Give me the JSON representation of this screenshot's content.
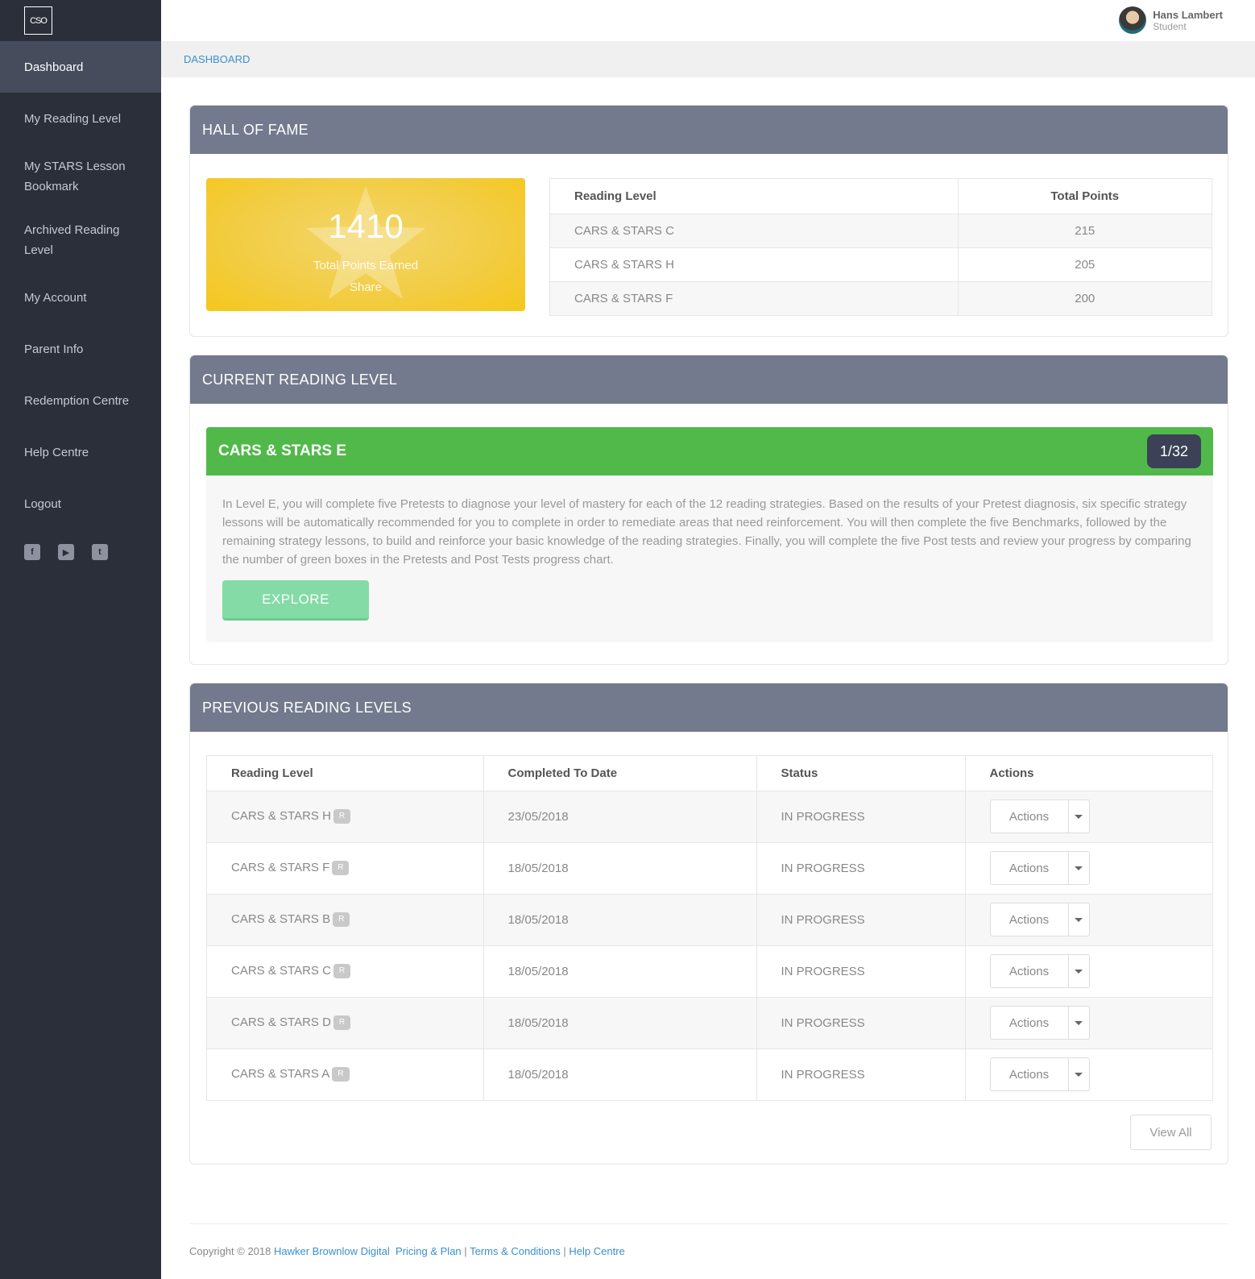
{
  "sidebar": {
    "logo": "CSO",
    "items": [
      {
        "label": "Dashboard"
      },
      {
        "label": "My Reading Level"
      },
      {
        "label": "My STARS Lesson Bookmark"
      },
      {
        "label": "Archived Reading Level"
      },
      {
        "label": "My Account"
      },
      {
        "label": "Parent Info"
      },
      {
        "label": "Redemption Centre"
      },
      {
        "label": "Help Centre"
      },
      {
        "label": "Logout"
      }
    ],
    "socials": [
      "facebook-icon",
      "youtube-icon",
      "twitter-icon"
    ]
  },
  "user": {
    "name": "Hans Lambert",
    "role": "Student"
  },
  "breadcrumb": "DASHBOARD",
  "hall_of_fame": {
    "title": "HALL OF FAME",
    "points": "1410",
    "points_label": "Total Points Earned",
    "share_label": "Share",
    "table": {
      "headers": [
        "Reading Level",
        "Total Points"
      ],
      "rows": [
        {
          "level": "CARS & STARS C",
          "points": "215"
        },
        {
          "level": "CARS & STARS H",
          "points": "205"
        },
        {
          "level": "CARS & STARS F",
          "points": "200"
        }
      ]
    }
  },
  "current_level": {
    "title": "CURRENT READING LEVEL",
    "level_name": "CARS & STARS E",
    "progress": "1/32",
    "description": "In Level E, you will complete five Pretests to diagnose your level of mastery for each of the 12 reading strategies. Based on the results of your Pretest diagnosis, six specific strategy lessons will be automatically recommended for you to complete in order to remediate areas that need reinforcement. You will then complete the five Benchmarks, followed by the remaining strategy lessons, to build and reinforce your basic knowledge of the reading strategies. Finally, you will complete the five Post tests and review your progress by comparing the number of green boxes in the Pretests and Post Tests progress chart.",
    "explore_label": "EXPLORE"
  },
  "previous_levels": {
    "title": "PREVIOUS READING LEVELS",
    "headers": [
      "Reading Level",
      "Completed To Date",
      "Status",
      "Actions"
    ],
    "badge": "R",
    "action_label": "Actions",
    "rows": [
      {
        "level": "CARS & STARS H",
        "date": "23/05/2018",
        "status": "IN PROGRESS"
      },
      {
        "level": "CARS & STARS F",
        "date": "18/05/2018",
        "status": "IN PROGRESS"
      },
      {
        "level": "CARS & STARS B",
        "date": "18/05/2018",
        "status": "IN PROGRESS"
      },
      {
        "level": "CARS & STARS C",
        "date": "18/05/2018",
        "status": "IN PROGRESS"
      },
      {
        "level": "CARS & STARS D",
        "date": "18/05/2018",
        "status": "IN PROGRESS"
      },
      {
        "level": "CARS & STARS A",
        "date": "18/05/2018",
        "status": "IN PROGRESS"
      }
    ],
    "view_all_label": "View All"
  },
  "footer": {
    "copyright": "Copyright © 2018",
    "company": "Hawker Brownlow Digital",
    "links": [
      "Pricing & Plan",
      "Terms & Conditions",
      "Help Centre"
    ],
    "separator": "|"
  }
}
